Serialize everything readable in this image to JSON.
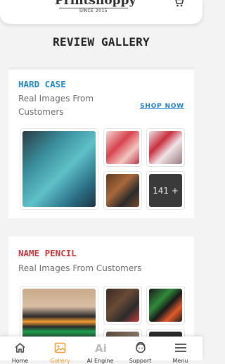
{
  "header": {
    "logo_name": "Printshoppy",
    "logo_tagline": "SINCE 2015"
  },
  "page_title": "REVIEW GALLERY",
  "sections": [
    {
      "title": "HARD CASE",
      "title_color": "#1d86c8",
      "subtitle": "Real Images From Customers",
      "link": "SHOP NOW",
      "more_count": "141 +"
    },
    {
      "title": "NAME PENCIL",
      "title_color": "#c8343c",
      "subtitle": "Real Images From Customers"
    }
  ],
  "tabbar": {
    "items": [
      {
        "label": "Home",
        "icon": "home-icon"
      },
      {
        "label": "Gallery",
        "icon": "gallery-icon"
      },
      {
        "label": "AI Engine",
        "icon": "ai-icon"
      },
      {
        "label": "Support",
        "icon": "support-icon"
      },
      {
        "label": "Menu",
        "icon": "menu-icon"
      }
    ],
    "active_color": "#f29b30"
  }
}
